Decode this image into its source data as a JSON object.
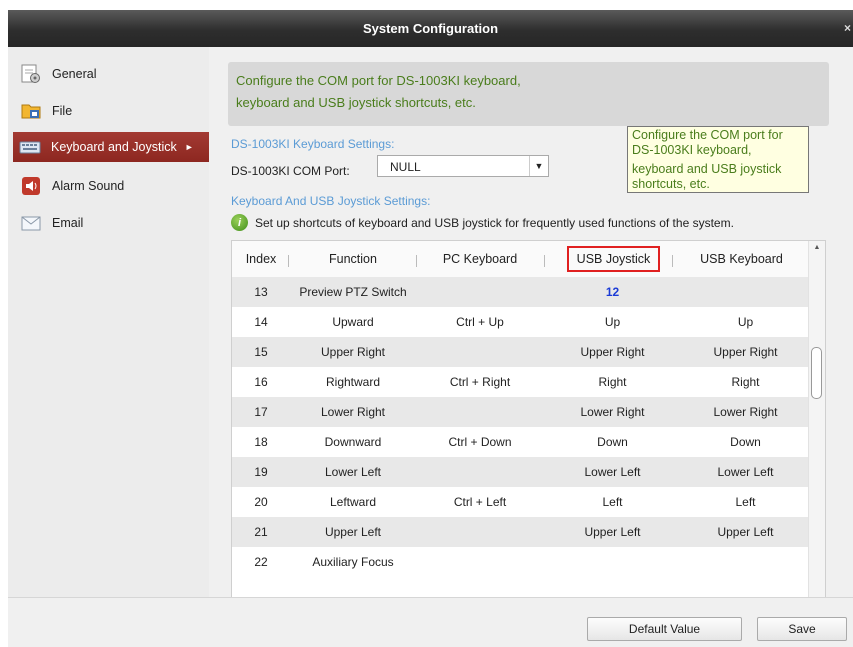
{
  "window": {
    "title": "System Configuration",
    "close": "×"
  },
  "sidebar": {
    "items": [
      {
        "label": "General",
        "icon": "general-settings-icon"
      },
      {
        "label": "File",
        "icon": "folder-icon"
      },
      {
        "label": "Keyboard and Joystick",
        "icon": "keyboard-icon",
        "active": true
      },
      {
        "label": "Alarm Sound",
        "icon": "speaker-icon"
      },
      {
        "label": "Email",
        "icon": "email-icon"
      }
    ]
  },
  "info": {
    "line1": "Configure the COM port for DS-1003KI keyboard,",
    "line2": "keyboard and USB joystick shortcuts, etc."
  },
  "keyboard_section": {
    "title": "DS-1003KI Keyboard Settings:",
    "com_port_label": "DS-1003KI COM Port:",
    "com_port_value": "NULL"
  },
  "tooltip": {
    "line1": "Configure the COM port for",
    "line2": "DS-1003KI keyboard,",
    "line3": "keyboard and USB joystick",
    "line4": "shortcuts, etc."
  },
  "joystick_section": {
    "title": "Keyboard And USB Joystick Settings:",
    "hint": "Set up shortcuts of keyboard and USB joystick for frequently used functions of the system."
  },
  "table": {
    "headers": [
      "Index",
      "Function",
      "PC Keyboard",
      "USB Joystick",
      "USB Keyboard"
    ],
    "rows": [
      [
        "13",
        "Preview PTZ Switch",
        "",
        "12",
        ""
      ],
      [
        "14",
        "Upward",
        "Ctrl + Up",
        "Up",
        "Up"
      ],
      [
        "15",
        "Upper Right",
        "",
        "Upper Right",
        "Upper Right"
      ],
      [
        "16",
        "Rightward",
        "Ctrl + Right",
        "Right",
        "Right"
      ],
      [
        "17",
        "Lower Right",
        "",
        "Lower Right",
        "Lower Right"
      ],
      [
        "18",
        "Downward",
        "Ctrl + Down",
        "Down",
        "Down"
      ],
      [
        "19",
        "Lower Left",
        "",
        "Lower Left",
        "Lower Left"
      ],
      [
        "20",
        "Leftward",
        "Ctrl + Left",
        "Left",
        "Left"
      ],
      [
        "21",
        "Upper Left",
        "",
        "Upper Left",
        "Upper Left"
      ],
      [
        "22",
        "Auxiliary Focus",
        "",
        "",
        ""
      ]
    ]
  },
  "footer": {
    "default_label": "Default Value",
    "save_label": "Save"
  },
  "colors": {
    "accent": "#8d2720",
    "info_text": "#4a7d1c",
    "section_title": "#5b9bd5",
    "highlight_border": "#e02020"
  }
}
